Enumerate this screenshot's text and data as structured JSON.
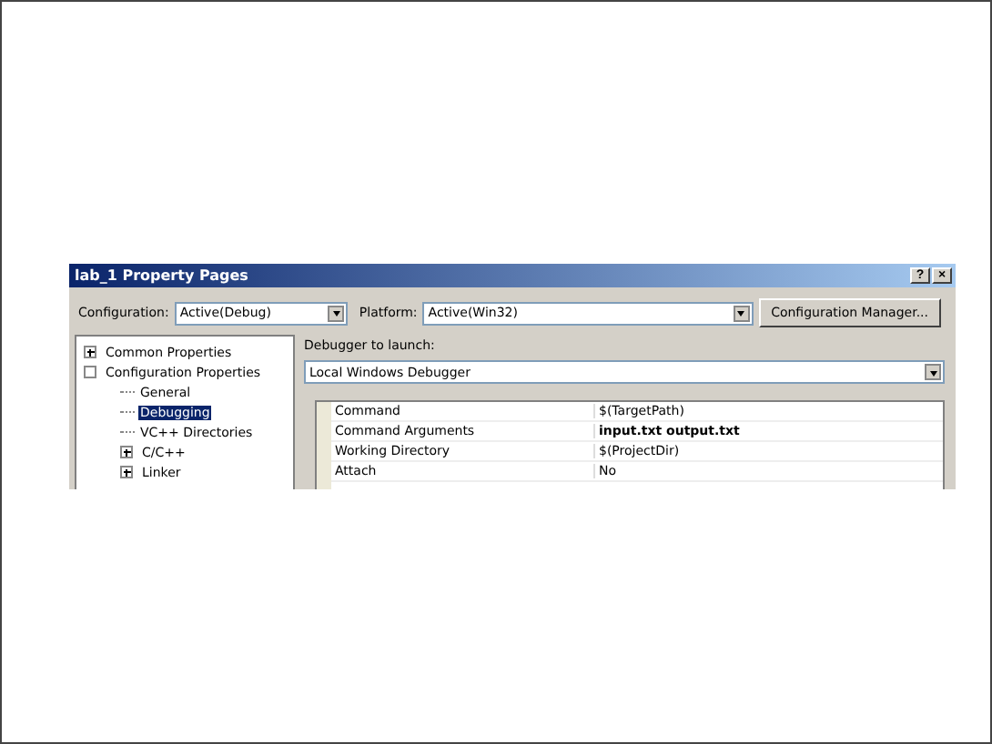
{
  "window": {
    "title": "lab_1 Property Pages",
    "title_buttons": [
      "?",
      "×"
    ]
  },
  "toolbar": {
    "configuration": {
      "label": "Configuration:",
      "value": "Active(Debug)"
    },
    "platform": {
      "label": "Platform:",
      "value": "Active(Win32)"
    },
    "button": "Configuration Manager..."
  },
  "tree": [
    {
      "label": "Common Properties",
      "expanded": false,
      "selected": false
    },
    {
      "label": "Configuration Properties",
      "expanded": true,
      "selected": false,
      "children": [
        {
          "label": "General",
          "selected": false
        },
        {
          "label": "Debugging",
          "selected": true
        },
        {
          "label": "VC++ Directories",
          "selected": false
        },
        {
          "label": "C/C++",
          "selected": false,
          "expanded": false
        },
        {
          "label": "Linker",
          "selected": false,
          "expanded": false
        }
      ]
    }
  ],
  "debugger": {
    "label": "Debugger to launch:",
    "value": "Local Windows Debugger"
  },
  "properties": [
    {
      "name": "Command",
      "value": "$(TargetPath)",
      "modified": false
    },
    {
      "name": "Command Arguments",
      "value": "input.txt output.txt",
      "modified": true
    },
    {
      "name": "Working Directory",
      "value": "$(ProjectDir)",
      "modified": false
    },
    {
      "name": "Attach",
      "value": "No",
      "modified": false
    }
  ]
}
